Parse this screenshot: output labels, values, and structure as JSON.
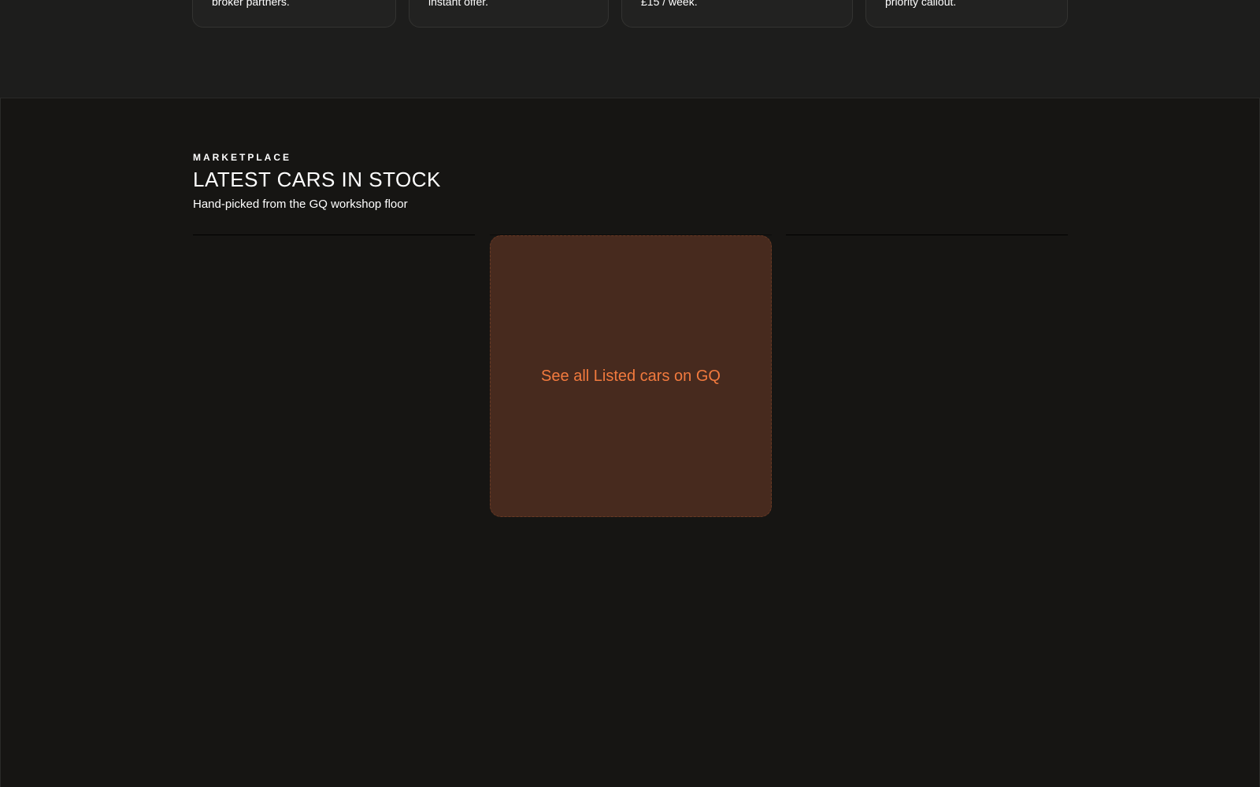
{
  "features": {
    "cards": [
      {
        "text": "broker partners."
      },
      {
        "text": "instant offer."
      },
      {
        "text": "£15 / week."
      },
      {
        "text": "priority callout."
      }
    ]
  },
  "marketplace": {
    "eyebrow": "MARKETPLACE",
    "title": "LATEST CARS IN STOCK",
    "subtitle": "Hand-picked from the GQ workshop floor",
    "see_all_label": "See all Listed cars on GQ"
  },
  "colors": {
    "page_background": "#161513",
    "features_background": "#1d1d1c",
    "card_background": "#222221",
    "accent": "#f27a3e",
    "see_all_background": "#472a1e"
  }
}
